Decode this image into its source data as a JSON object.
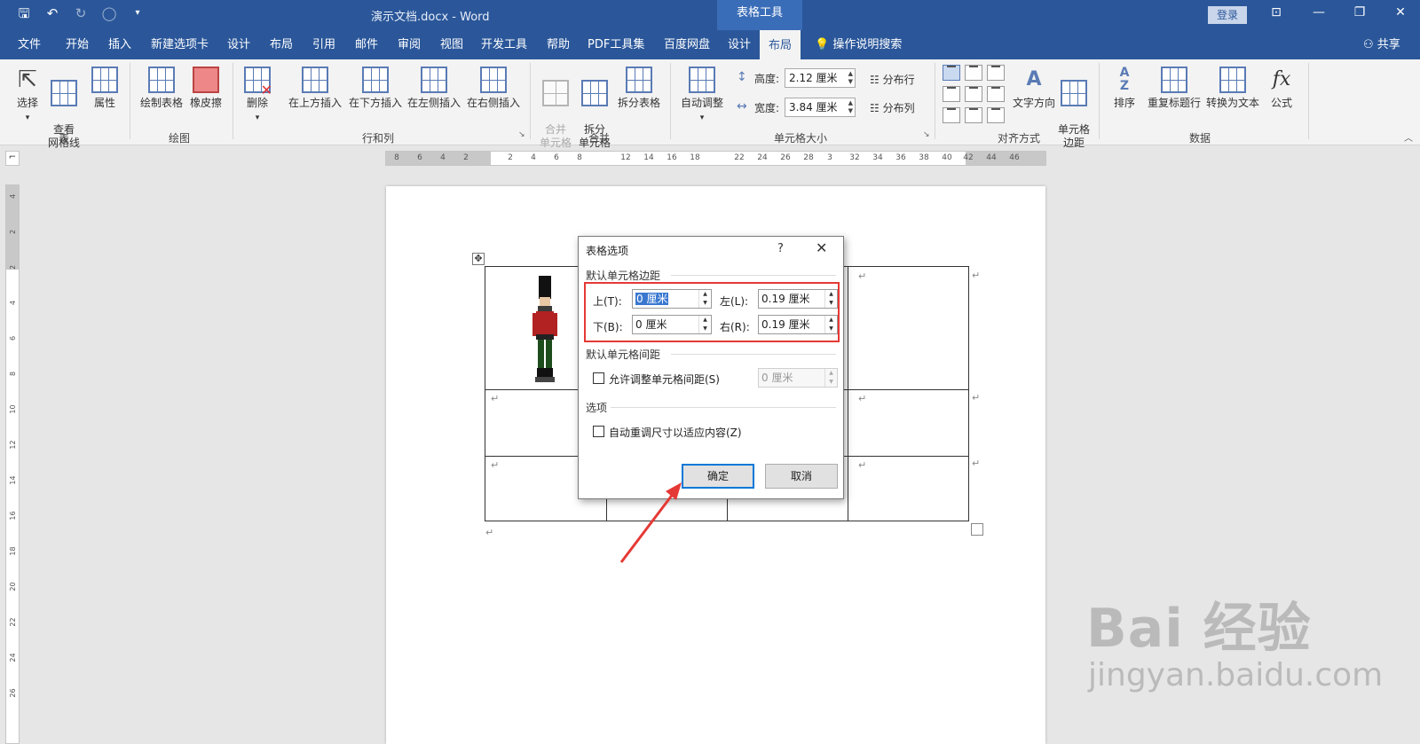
{
  "window": {
    "doc_title": "演示文档.docx - Word",
    "context_group": "表格工具",
    "login": "登录",
    "share": "共享",
    "help_search": "操作说明搜索"
  },
  "menu": [
    "文件",
    "开始",
    "插入",
    "新建选项卡",
    "设计",
    "布局",
    "引用",
    "邮件",
    "审阅",
    "视图",
    "开发工具",
    "帮助",
    "PDF工具集",
    "百度网盘",
    "设计",
    "布局"
  ],
  "ribbon": {
    "buttons": {
      "select": "选择",
      "gridlines": "查看\n网格线",
      "properties": "属性",
      "draw_table": "绘制表格",
      "eraser": "橡皮擦",
      "delete": "删除",
      "insert_above": "在上方插入",
      "insert_below": "在下方插入",
      "insert_left": "在左侧插入",
      "insert_right": "在右侧插入",
      "merge_cells": "合并\n单元格",
      "split_cells": "拆分\n单元格",
      "split_table": "拆分表格",
      "autofit": "自动调整",
      "text_direction": "文字方向",
      "cell_margins": "单元格\n边距",
      "sort": "排序",
      "repeat_header": "重复标题行",
      "convert_text": "转换为文本",
      "formula": "公式"
    },
    "cell_size": {
      "height_label": "高度:",
      "height_value": "2.12 厘米",
      "width_label": "宽度:",
      "width_value": "3.84 厘米",
      "dist_rows": "分布行",
      "dist_cols": "分布列"
    },
    "groups": [
      "表",
      "绘图",
      "行和列",
      "合并",
      "单元格大小",
      "对齐方式",
      "数据"
    ]
  },
  "ruler": {
    "h_ticks": [
      "8",
      "6",
      "4",
      "2",
      "2",
      "4",
      "6",
      "8",
      "12",
      "14",
      "16",
      "18",
      "22",
      "24",
      "26",
      "28",
      "3",
      "32",
      "34",
      "36",
      "38",
      "40",
      "42",
      "44",
      "46"
    ],
    "v_ticks": [
      "4",
      "2",
      "2",
      "4",
      "6",
      "8",
      "10",
      "12",
      "14",
      "16",
      "18",
      "20",
      "22",
      "24",
      "26"
    ]
  },
  "dialog": {
    "title": "表格选项",
    "help": "?",
    "close": "✕",
    "section_margins": "默认单元格边距",
    "top_label": "上(T):",
    "top_value": "0 厘米",
    "left_label": "左(L):",
    "left_value": "0.19 厘米",
    "bottom_label": "下(B):",
    "bottom_value": "0 厘米",
    "right_label": "右(R):",
    "right_value": "0.19 厘米",
    "section_spacing": "默认单元格间距",
    "allow_spacing_label": "允许调整单元格间距(S)",
    "spacing_value": "0 厘米",
    "section_options": "选项",
    "autoresize_label": "自动重调尺寸以适应内容(Z)",
    "ok": "确定",
    "cancel": "取消"
  },
  "watermark": {
    "brand": "Bai 经验",
    "url": "jingyan.baidu.com"
  },
  "colors": {
    "title_bar": "#2b579a",
    "highlight": "#e53935",
    "default_button_border": "#0078d7"
  }
}
